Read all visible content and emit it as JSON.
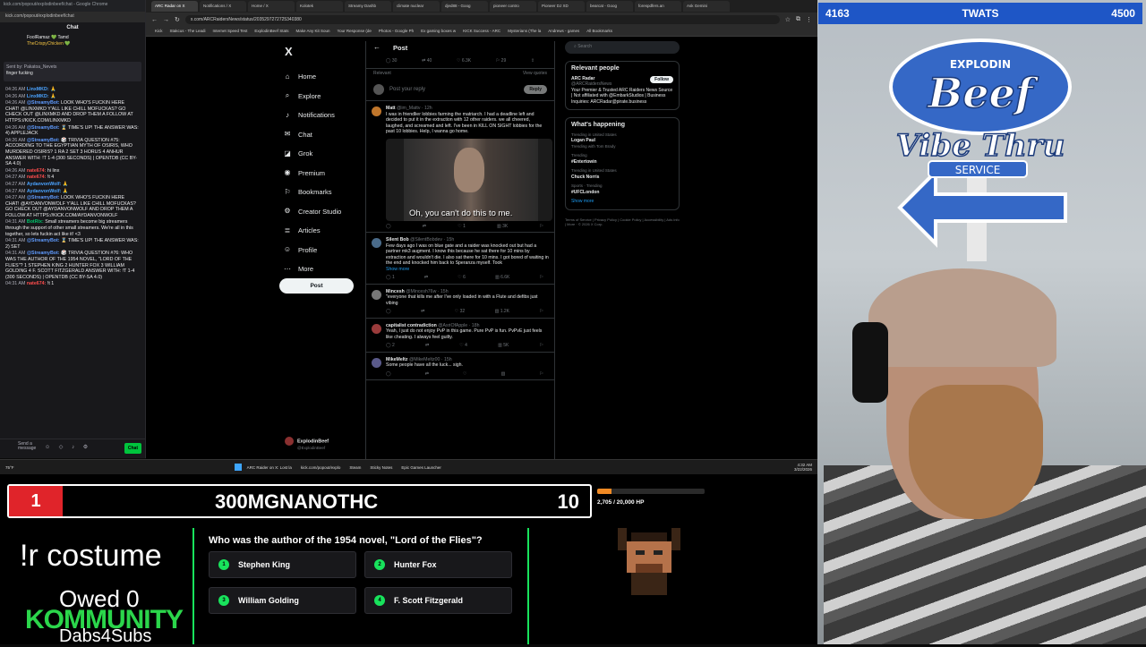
{
  "chat": {
    "window_title": "kick.com/popout/explodinbeef/chat - Google Chrome",
    "address": "kick.com/popout/explodinbeef/chat",
    "title": "Chat",
    "gift_line1": "FoolRamaz 💚 Tamd",
    "gift_line2": "TheCrispyChicken 💚",
    "pinned_user": "Sent by: Pakatoa_Nevets",
    "pinned_text": "finger fucking",
    "messages": [
      {
        "time": "04:26 AM",
        "user": "LinxMKD:",
        "text": "🙏"
      },
      {
        "time": "04:26 AM",
        "user": "LinxMKD:",
        "text": "🙏"
      },
      {
        "time": "04:26 AM",
        "user": "@StreamyBot:",
        "text": "LOOK WHO'S FUCKIN HERE CHAT! @LINXMKD Y'ALL LIKE CHILL MOFUCKAS? GO CHECK OUT @LINXMKD AND DROP THEM A FOLLOW AT HTTPS://KICK.COM/LINXMKD"
      },
      {
        "time": "04:26 AM",
        "user": "@StreamyBot:",
        "text": "⌛ TIME'S UP! THE ANSWER WAS: 4) APPLEJACK"
      },
      {
        "time": "04:26 AM",
        "user": "@StreamyBot:",
        "text": "🎲 TRIVIA QUESTION #75: ACCORDING TO THE EGYPTIAN MYTH OF OSIRIS, WHO MURDERED OSIRIS? 1 RA 2 SET 3 HORUS 4 ANHUR ANSWER WITH: !T 1-4 (300 SECONDS) | OPENTDB (CC BY-SA 4.0)"
      },
      {
        "time": "04:26 AM",
        "user": "nate674:",
        "text": "hi linx"
      },
      {
        "time": "04:27 AM",
        "user": "nate674:",
        "text": "!t 4"
      },
      {
        "time": "04:27 AM",
        "user": "AydanvonWolf:",
        "text": "🙏"
      },
      {
        "time": "04:27 AM",
        "user": "AydanvonWolf:",
        "text": "🙏"
      },
      {
        "time": "04:27 AM",
        "user": "@StreamyBot:",
        "text": "LOOK WHO'S FUCKIN HERE CHAT! @AYDANVONWOLF Y'ALL LIKE CHILL MOFUCKAS? GO CHECK OUT @AYDANVONWOLF AND DROP THEM A FOLLOW AT HTTPS://KICK.COM/AYDANVONWOLF"
      },
      {
        "time": "04:31 AM",
        "user": "BotRix:",
        "text": "Small streamers become big streamers through the support of other small streamers. We're all in this together, so lets fuckin act like it! <3"
      },
      {
        "time": "04:31 AM",
        "user": "@StreamyBot:",
        "text": "⌛ TIME'S UP! THE ANSWER WAS: 2) SET"
      },
      {
        "time": "04:31 AM",
        "user": "@StreamyBot:",
        "text": "🎲 TRIVIA QUESTION #76: WHO WAS THE AUTHOR OF THE 1954 NOVEL, \"LORD OF THE FLIES\"? 1 STEPHEN KING 2 HUNTER FOX 3 WILLIAM GOLDING 4 F. SCOTT FITZGERALD ANSWER WITH: !T 1-4 (300 SECONDS) | OPENTDB (CC BY-SA 4.0)"
      },
      {
        "time": "04:31 AM",
        "user": "nate674:",
        "text": "!t 1"
      }
    ],
    "input_placeholder": "Send a message",
    "send_label": "Chat"
  },
  "browser": {
    "tabs": [
      "ARC Radar on X",
      "Notifications / X",
      "Home / X",
      "Kolotek",
      "Streamy Dashb",
      "climate nuclear",
      "djed88 - Goog",
      "pioneer contro",
      "Pioneer DJ XD",
      "bearcat - Goog",
      "forespdfers.an",
      "Ask Gemini"
    ],
    "url": "x.com/ARCRaidersNews/status/2035297272725340380",
    "bookmarks": [
      "Kick",
      "Stakcus - The Leadi",
      "Internet Speed Test",
      "ExplodinBeef Stats",
      "Make Any Kit Soun",
      "Your Response (de",
      "Photos - Google Ph",
      "Ex gaming boxes w",
      "KICK Success - ARC",
      "Mysterians (The la",
      "Andrews - games",
      "All Bookmarks"
    ]
  },
  "x": {
    "logo": "X",
    "nav": [
      {
        "icon": "⌂",
        "label": "Home"
      },
      {
        "icon": "⌕",
        "label": "Explore"
      },
      {
        "icon": "♪",
        "label": "Notifications"
      },
      {
        "icon": "✉",
        "label": "Chat"
      },
      {
        "icon": "◪",
        "label": "Grok"
      },
      {
        "icon": "◉",
        "label": "Premium"
      },
      {
        "icon": "⚐",
        "label": "Bookmarks"
      },
      {
        "icon": "⚙",
        "label": "Creator Studio"
      },
      {
        "icon": "≣",
        "label": "Articles"
      },
      {
        "icon": "☺",
        "label": "Profile"
      },
      {
        "icon": "⋯",
        "label": "More"
      }
    ],
    "post_button": "Post",
    "user_name": "ExplodinBeef",
    "user_handle": "@ExplodinBeef",
    "feed": {
      "header": "Post",
      "stats": [
        "30",
        "40",
        "6.3K",
        "29",
        ""
      ],
      "relevant_label": "Relevant",
      "view_quotes": "View quotes",
      "reply_placeholder": "Post your reply",
      "reply_button": "Reply",
      "tweets": [
        {
          "name": "Matt",
          "handle": "@im_Mattv · 12h",
          "text": "I was in friendlier lobbies farming the matriarch. I had a deadline left and decided to put it in the extraction with 12 other raiders. we all cheered, laughed, and screamed and left. I've been in KILL ON SIGHT lobbies for the past 10 lobbies. Help, I wanna go home.",
          "meme_caption": "Oh, you can't do this to me.",
          "acts": [
            "",
            "",
            "1",
            "3K"
          ]
        },
        {
          "name": "Silent Bob",
          "handle": "@SilentBobdev · 15h",
          "text": "Few days ago I was on blue gate and a raider was knocked out but had a partner mk3 augment. I know this because he sat there for 10 mins by extraction and wouldn't die. I also sat there for 10 mins. I got bored of waiting in the end and knocked him back to Speranza myself. Took",
          "show_more": "Show more",
          "acts": [
            "1",
            "",
            "6",
            "6.6K"
          ]
        },
        {
          "name": "Mincesh",
          "handle": "@Mincesh76w · 15h",
          "text": "\"everyone that kills me after I've only loaded in with a Flute and defibs just vibing",
          "acts": [
            "",
            "",
            "32",
            "1.2K"
          ]
        },
        {
          "name": "capitalist contradiction",
          "handle": "@AsriOfApple · 18h",
          "text": "Yeah, I just do not enjoy PvP in this game. Pure PvP is fun. PvPvE just feels like cheating. I always feel guilty.",
          "acts": [
            "2",
            "",
            "4",
            "5K"
          ]
        },
        {
          "name": "MikeMeltz",
          "handle": "@MikeMeltz00 · 15h",
          "text": "Some people have all the luck... sigh.",
          "acts": [
            "",
            "",
            "",
            ""
          ]
        }
      ]
    },
    "right": {
      "search_placeholder": "Search",
      "relevant_title": "Relevant people",
      "person_name": "ARC Radar",
      "person_handle": "@ARCRaidersNews",
      "follow_label": "Follow",
      "person_bio": "Your Premier & Trusted ARC Raiders News Source | Not affiliated with @EmbarkStudios | Business Inquiries: ARCRadar@pirate.business",
      "happening_title": "What's happening",
      "trends": [
        {
          "sub": "Trending in United States",
          "tag": "Logan Paul",
          "extra": "Trending with Tom Brady"
        },
        {
          "sub": "Trending",
          "tag": "#Entertowin",
          "extra": ""
        },
        {
          "sub": "Trending in United States",
          "tag": "Chuck Norris",
          "extra": ""
        },
        {
          "sub": "Sports · Trending",
          "tag": "#UFCLondon",
          "extra": ""
        }
      ],
      "show_more": "Show more",
      "footer": "Terms of Service | Privacy Policy | Cookie Policy | Accessibility | Ads info | More · © 2026 X Corp."
    }
  },
  "taskbar": {
    "weather": "75°F",
    "apps": [
      "ARC Raider on X: Lost la",
      "kick.com/popout/explo",
      "Steam",
      "Sticky Notes",
      "Epic Games Launcher"
    ],
    "time": "4:32 AM",
    "date": "3/22/2026"
  },
  "overlay": {
    "leader_left": "4163",
    "leader_name": "TWATS",
    "leader_right": "4500",
    "logo_top": "EXPLODIN",
    "logo_word": "Beef",
    "logo_line2": "Vibe Thru",
    "logo_line3": "SERVICE",
    "rank": "1",
    "rank_name": "300MGNANOTHC",
    "rank_count": "10",
    "hp_current": 2705,
    "hp_max": 20000,
    "hp_text": "2,705 / 20,000 HP",
    "command": "!r costume",
    "owed": "Owed 0",
    "kommunity": "KOMMUNITY",
    "dabs": "Dabs4Subs",
    "trivia_question": "Who was the author of the 1954 novel, \"Lord of the Flies\"?",
    "trivia_options": [
      "Stephen King",
      "Hunter Fox",
      "William Golding",
      "F. Scott Fitzgerald"
    ],
    "trivia_numbers": [
      "1",
      "2",
      "3",
      "4"
    ]
  },
  "colors": {
    "kick_green": "#18e35c",
    "leader_blue": "#1e56c6",
    "rank_red": "#e0242a",
    "x_link": "#1d9bf0"
  }
}
